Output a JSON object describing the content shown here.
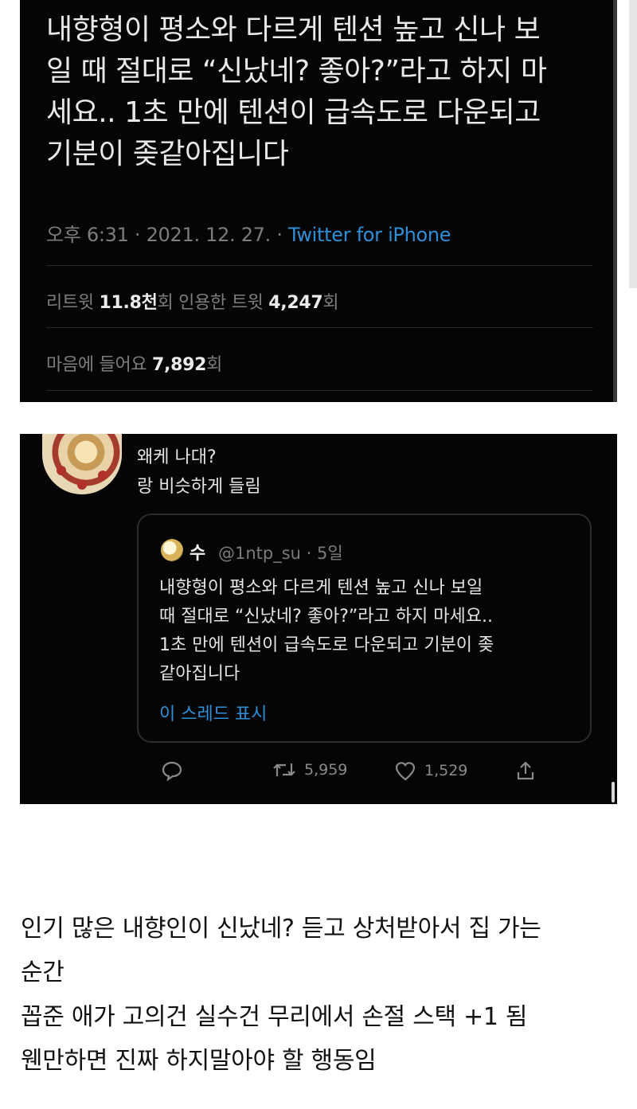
{
  "tweet": {
    "text": "내향형이 평소와 다르게 텐션 높고 신나 보\n일 때 절대로 “신났네? 좋아?”라고 하지 마\n세요.. 1초 만에 텐션이 급속도로 다운되고\n기분이 좆같아집니다",
    "timestamp": "오후 6:31 · 2021. 12. 27. · ",
    "source": "Twitter for iPhone",
    "retweet_label": "리트윗 ",
    "retweet_count": "11.8천",
    "retweet_suffix": "회  인용한 트윗 ",
    "quote_count": "4,247",
    "quote_suffix": "회",
    "likes_label": "마음에 들어요 ",
    "likes_count": "7,892",
    "likes_suffix": "회"
  },
  "reply": {
    "line1": "왜케 나대?",
    "line2": "랑 비슷하게 들림",
    "quoted": {
      "name": "수",
      "handle": "@1ntp_su · 5일",
      "text": "내향형이 평소와 다르게 텐션 높고 신나 보일\n때 절대로 “신났네? 좋아?”라고 하지 마세요..\n1초 만에 텐션이 급속도로 다운되고 기분이 좆\n같아집니다",
      "thread_link": "이 스레드 표시"
    },
    "retweets": "5,959",
    "likes": "1,529"
  },
  "caption": {
    "line1": "인기 많은 내향인이 신났네? 듣고 상처받아서 집 가는",
    "line2": "순간",
    "line3": "꼽준 애가 고의건 실수건 무리에서 손절 스택 +1 됨",
    "line4": "웬만하면 진짜 하지말아야 할 행동임"
  },
  "colors": {
    "background": "#050505",
    "text": "#e9e9e9",
    "muted": "#7d7d7d",
    "link": "#2d8fd8"
  }
}
